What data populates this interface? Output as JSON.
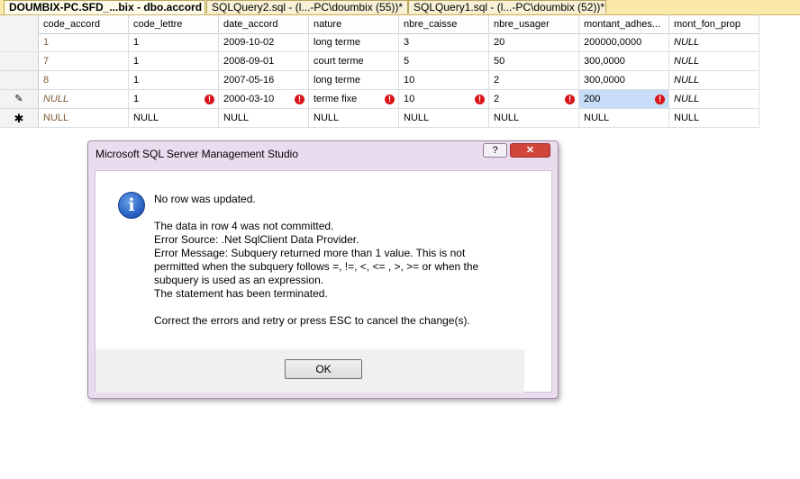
{
  "tabs": [
    {
      "label": "DOUMBIX-PC.SFD_...bix - dbo.accord"
    },
    {
      "label": "SQLQuery2.sql - (l...-PC\\doumbix (55))*"
    },
    {
      "label": "SQLQuery1.sql - (l...-PC\\doumbix (52))*"
    }
  ],
  "grid": {
    "columns": [
      "code_accord",
      "code_lettre",
      "date_accord",
      "nature",
      "nbre_caisse",
      "nbre_usager",
      "montant_adhes...",
      "mont_fon_prop"
    ],
    "rows": [
      [
        "1",
        "1",
        "2009-10-02",
        "long terme",
        "3",
        "20",
        "200000,0000",
        "NULL"
      ],
      [
        "7",
        "1",
        "2008-09-01",
        "court terme",
        "5",
        "50",
        "300,0000",
        "NULL"
      ],
      [
        "8",
        "1",
        "2007-05-16",
        "long terme",
        "10",
        "2",
        "300,0000",
        "NULL"
      ],
      [
        "NULL",
        "1",
        "2000-03-10",
        "terme fixe",
        "10",
        "2",
        "200",
        "NULL"
      ],
      [
        "NULL",
        "NULL",
        "NULL",
        "NULL",
        "NULL",
        "NULL",
        "NULL",
        "NULL"
      ]
    ],
    "row_markers": [
      "",
      "",
      "",
      "✎",
      "✱"
    ],
    "error_marker": "!"
  },
  "dialog": {
    "title": "Microsoft SQL Server Management Studio",
    "help_label": "?",
    "close_label": "✕",
    "icon_glyph": "i",
    "lines": [
      "No row was updated.",
      "The data in row 4 was not committed.",
      "Error Source: .Net SqlClient Data Provider.",
      "Error Message: Subquery returned more than 1 value. This is not",
      "permitted when the subquery follows =, !=, <, <= , >, >= or when the",
      "subquery is used as an expression.",
      "The statement has been terminated.",
      "Correct the errors and retry or press ESC to cancel the change(s)."
    ],
    "ok_label": "OK"
  }
}
